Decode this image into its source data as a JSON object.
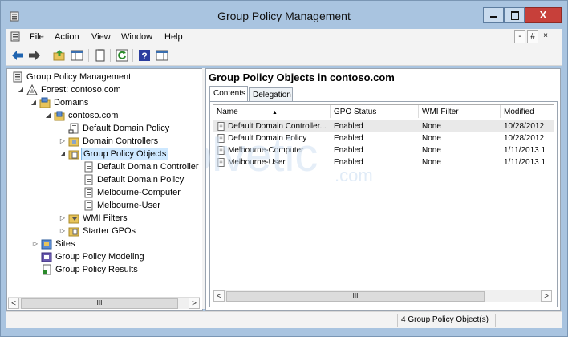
{
  "window": {
    "title": "Group Policy Management",
    "controls": {
      "minimize": "minimize",
      "maximize": "maximize",
      "close": "X"
    }
  },
  "menubar": {
    "items": [
      "File",
      "Action",
      "View",
      "Window",
      "Help"
    ],
    "mdi_buttons": [
      "-",
      "#",
      "×"
    ]
  },
  "toolbar": {
    "buttons": [
      "back-arrow-icon",
      "forward-arrow-icon",
      "up-folder-icon",
      "show-hide-tree-icon",
      "properties-icon",
      "refresh-icon",
      "help-icon",
      "show-hide-action-pane-icon"
    ]
  },
  "tree": {
    "nodes": [
      {
        "label": "Group Policy Management",
        "icon": "gpm-icon"
      },
      {
        "label": "Forest: contoso.com",
        "icon": "forest-icon"
      },
      {
        "label": "Domains",
        "icon": "domains-icon"
      },
      {
        "label": "contoso.com",
        "icon": "domain-icon"
      },
      {
        "label": "Default Domain Policy",
        "icon": "gpo-link-icon"
      },
      {
        "label": "Domain Controllers",
        "icon": "ou-icon"
      },
      {
        "label": "Group Policy Objects",
        "icon": "gpo-folder-icon",
        "selected": true
      },
      {
        "label": "Default Domain Controller",
        "icon": "gpo-icon"
      },
      {
        "label": "Default Domain Policy",
        "icon": "gpo-icon"
      },
      {
        "label": "Melbourne-Computer",
        "icon": "gpo-icon"
      },
      {
        "label": "Melbourne-User",
        "icon": "gpo-icon"
      },
      {
        "label": "WMI Filters",
        "icon": "wmi-filters-icon"
      },
      {
        "label": "Starter GPOs",
        "icon": "starter-gpos-icon"
      },
      {
        "label": "Sites",
        "icon": "sites-icon"
      },
      {
        "label": "Group Policy Modeling",
        "icon": "modeling-icon"
      },
      {
        "label": "Group Policy Results",
        "icon": "results-icon"
      }
    ],
    "scroll_thumb": "III"
  },
  "details": {
    "title": "Group Policy Objects in contoso.com",
    "tabs": [
      "Contents",
      "Delegation"
    ],
    "active_tab": "Contents",
    "columns": [
      "Name",
      "GPO Status",
      "WMI Filter",
      "Modified"
    ],
    "rows": [
      {
        "name": "Default Domain Controller...",
        "status": "Enabled",
        "wmi": "None",
        "modified": "10/28/2012"
      },
      {
        "name": "Default Domain Policy",
        "status": "Enabled",
        "wmi": "None",
        "modified": "10/28/2012"
      },
      {
        "name": "Melbourne-Computer",
        "status": "Enabled",
        "wmi": "None",
        "modified": "1/11/2013 1"
      },
      {
        "name": "Melbourne-User",
        "status": "Enabled",
        "wmi": "None",
        "modified": "1/11/2013 1"
      }
    ],
    "scroll_thumb": "III"
  },
  "statusbar": {
    "text": "4 Group Policy Object(s)"
  },
  "colors": {
    "chrome": "#a9c4e0",
    "selection": "#cde8ff",
    "close": "#c7403a"
  }
}
